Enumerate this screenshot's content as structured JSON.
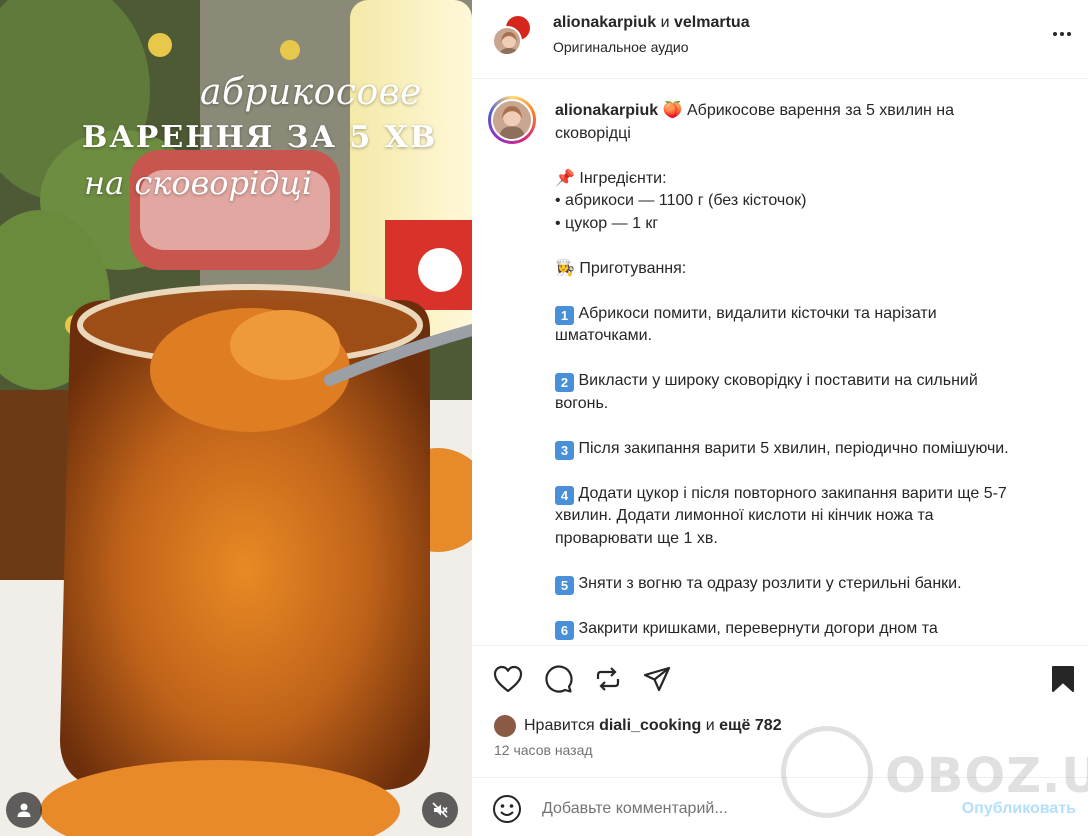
{
  "media": {
    "overlay_line1": "абрикосове",
    "overlay_line2": "ВАРЕННЯ ЗА 5 ХВ",
    "overlay_line3": "на сковорідці",
    "user_icon": "user-icon",
    "mute_icon": "muted-speaker-icon"
  },
  "header": {
    "user1": "alionakarpiuk",
    "joiner": "и",
    "user2": "velmartua",
    "audio": "Оригинальное аудио",
    "more_icon": "more-horizontal-icon"
  },
  "caption": {
    "username": "alionakarpiuk",
    "lines": [
      {
        "emoji": "🍑",
        "text": "Абрикосове варення за 5 хвилин на"
      },
      {
        "text": "сковорідці"
      },
      {
        "text": ""
      },
      {
        "emoji": "📌",
        "text": "Інгредієнти:"
      },
      {
        "text": "• абрикоси — 1100 г (без кісточок)"
      },
      {
        "text": "• цукор — 1 кг"
      },
      {
        "text": ""
      },
      {
        "emoji": "👩‍🍳",
        "text": "Приготування:"
      },
      {
        "text": ""
      },
      {
        "num": "1",
        "text": "Абрикоси помити, видалити кісточки та нарізати"
      },
      {
        "text": "шматочками."
      },
      {
        "text": ""
      },
      {
        "num": "2",
        "text": "Викласти у широку сковорідку і поставити на сильний"
      },
      {
        "text": "вогонь."
      },
      {
        "text": ""
      },
      {
        "num": "3",
        "text": "Після закипання варити 5 хвилин, періодично помішуючи."
      },
      {
        "text": ""
      },
      {
        "num": "4",
        "text": "Додати цукор і після повторного закипання варити ще 5-7"
      },
      {
        "text": "хвилин. Додати лимонної кислоти ні кінчик ножа та"
      },
      {
        "text": "проварювати ще 1 хв."
      },
      {
        "text": ""
      },
      {
        "num": "5",
        "text": "Зняти з вогню та одразу розлити у стерильні банки."
      },
      {
        "text": ""
      },
      {
        "num": "6",
        "text": "Закрити кришками, перевернути догори дном та"
      }
    ]
  },
  "actions": {
    "like_icon": "heart-icon",
    "comment_icon": "comment-icon",
    "repost_icon": "repost-icon",
    "share_icon": "share-icon",
    "save_icon": "bookmark-icon"
  },
  "likes": {
    "prefix": "Нравится",
    "user": "diali_cooking",
    "middle": "и",
    "rest": "ещё 782"
  },
  "timestamp": "12 часов назад",
  "comment": {
    "placeholder": "Добавьте комментарий...",
    "publish": "Опубликовать",
    "emoji_icon": "smiley-icon"
  },
  "watermark": "OBOZ.UA"
}
